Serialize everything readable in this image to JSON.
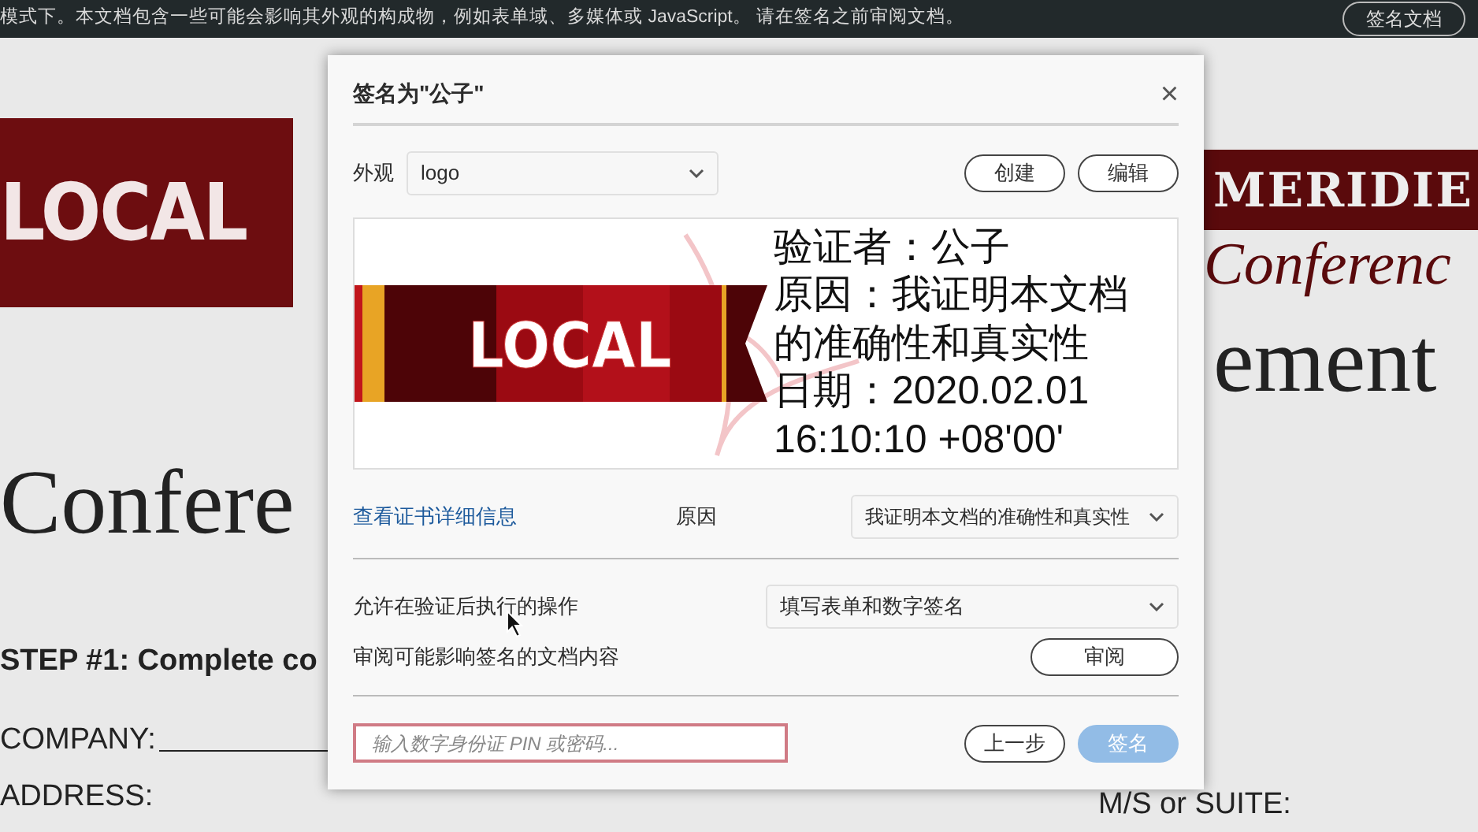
{
  "top_bar": {
    "message": "模式下。本文档包含一些可能会影响其外观的构成物，例如表单域、多媒体或 JavaScript。 请在签名之前审阅文档。",
    "button": "签名文档"
  },
  "document": {
    "left_logo": "LOCAL",
    "right_logo_title": "MERIDIE",
    "right_logo_subtitle": "Conferenc",
    "heading_left": "Confere",
    "heading_right": "ement",
    "step": "STEP #1: Complete co",
    "company_label": "COMPANY:",
    "address_label": "ADDRESS:",
    "suite_label": "M/S or SUITE:"
  },
  "dialog": {
    "title": "签名为\"公子\"",
    "close": "×",
    "appearance": {
      "label": "外观",
      "value": "logo",
      "buttons": [
        "创建",
        "编辑"
      ]
    },
    "preview": {
      "logo_text": "LOCAL",
      "lines": [
        "验证者：公子",
        "原因：我证明本文档的准确性和真实性",
        "日期：2020.02.01 16:10:10 +08'00'"
      ]
    },
    "details_link": "查看证书详细信息",
    "reason": {
      "label": "原因",
      "value": "我证明本文档的准确性和真实性"
    },
    "permissions": {
      "label": "允许在验证后执行的操作",
      "value": "填写表单和数字签名"
    },
    "review": {
      "label": "审阅可能影响签名的文档内容",
      "button": "审阅"
    },
    "pin": {
      "placeholder": "输入数字身份证 PIN 或密码..."
    },
    "footer_buttons": [
      {
        "label": "上一步",
        "kind": "secondary",
        "disabled": false
      },
      {
        "label": "签名",
        "kind": "primary",
        "disabled": true
      }
    ]
  }
}
